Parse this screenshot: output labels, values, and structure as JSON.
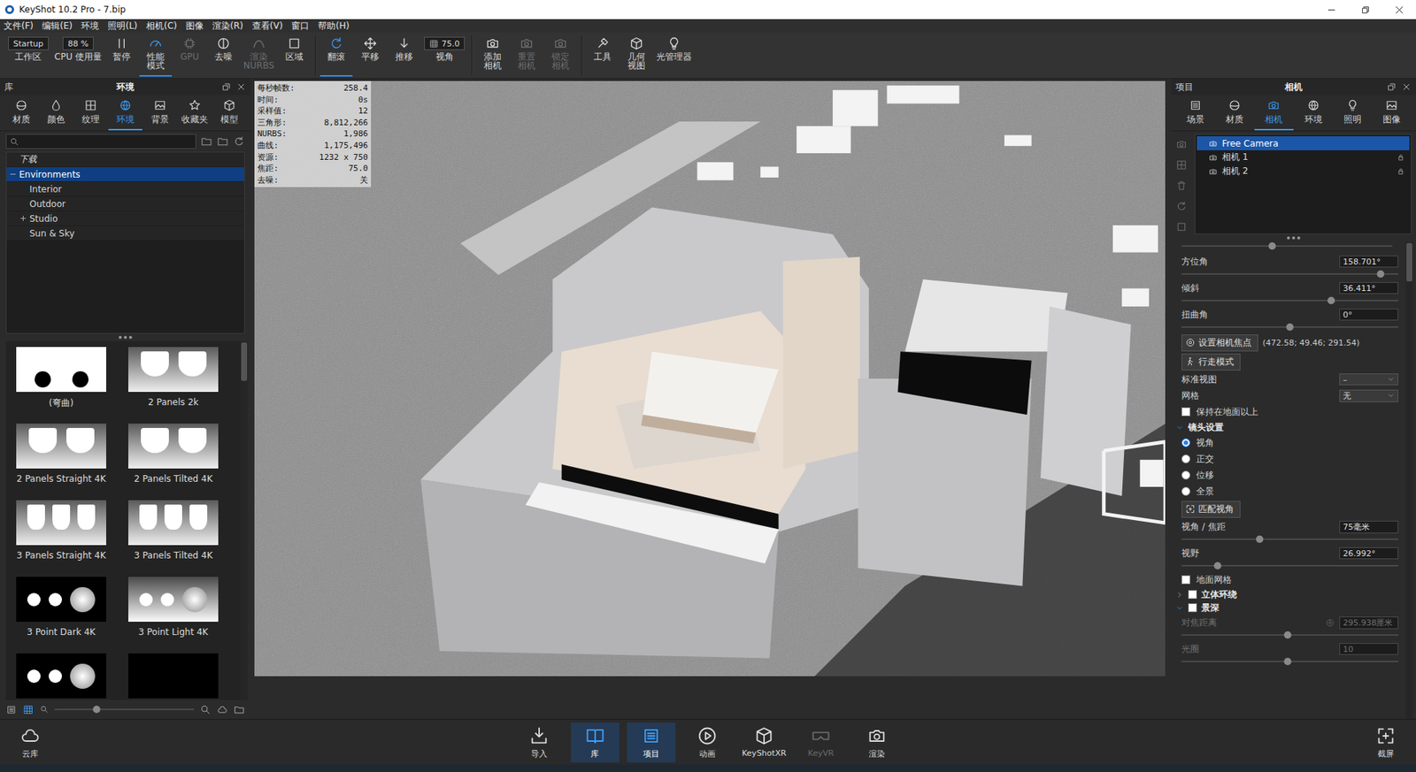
{
  "window": {
    "title": "KeyShot 10.2 Pro - 7.bip"
  },
  "menu": [
    "文件(F)",
    "编辑(E)",
    "环境",
    "照明(L)",
    "相机(C)",
    "图像",
    "渲染(R)",
    "查看(V)",
    "窗口",
    "帮助(H)"
  ],
  "toolbar": {
    "groups": [
      [
        {
          "kind": "field",
          "value": "Startup",
          "label": "工作区",
          "selected": false,
          "disabled": false
        },
        {
          "kind": "field",
          "value": "88 %",
          "label": "CPU 使用量",
          "selected": false,
          "disabled": false
        },
        {
          "kind": "icon",
          "label": "暂停",
          "selected": false,
          "disabled": false
        },
        {
          "kind": "icon",
          "label": "性能\n模式",
          "selected": true,
          "disabled": false
        },
        {
          "kind": "icon",
          "label": "GPU",
          "selected": false,
          "disabled": true
        },
        {
          "kind": "icon",
          "label": "去噪",
          "selected": false,
          "disabled": false
        },
        {
          "kind": "icon",
          "label": "渲染\nNURBS",
          "selected": false,
          "disabled": true
        },
        {
          "kind": "icon",
          "label": "区域",
          "selected": false,
          "disabled": false
        }
      ],
      [
        {
          "kind": "icon",
          "label": "翻滚",
          "selected": true,
          "disabled": false
        },
        {
          "kind": "icon",
          "label": "平移",
          "selected": false,
          "disabled": false
        },
        {
          "kind": "icon",
          "label": "推移",
          "selected": false,
          "disabled": false
        },
        {
          "kind": "field-icon",
          "value": "75.0",
          "label": "视角",
          "selected": false,
          "disabled": false
        }
      ],
      [
        {
          "kind": "icon",
          "label": "添加\n相机",
          "selected": false,
          "disabled": false
        },
        {
          "kind": "icon",
          "label": "重置\n相机",
          "selected": false,
          "disabled": true
        },
        {
          "kind": "icon",
          "label": "锁定\n相机",
          "selected": false,
          "disabled": true
        }
      ],
      [
        {
          "kind": "icon",
          "label": "工具",
          "selected": false,
          "disabled": false
        },
        {
          "kind": "icon",
          "label": "几何\n视图",
          "selected": false,
          "disabled": false
        },
        {
          "kind": "icon",
          "label": "光管理器",
          "selected": false,
          "disabled": false
        }
      ]
    ]
  },
  "library": {
    "header": "库",
    "title": "环境",
    "tabs": [
      {
        "label": "材质",
        "selected": false
      },
      {
        "label": "颜色",
        "selected": false
      },
      {
        "label": "纹理",
        "selected": false
      },
      {
        "label": "环境",
        "selected": true
      },
      {
        "label": "背景",
        "selected": false
      },
      {
        "label": "收藏夹",
        "selected": false
      },
      {
        "label": "模型",
        "selected": false
      }
    ],
    "tree": [
      {
        "label": "下载",
        "level": 0,
        "italic": true,
        "expandable": false,
        "expanded": false,
        "selected": false
      },
      {
        "label": "Environments",
        "level": 0,
        "italic": false,
        "expandable": true,
        "expanded": true,
        "selected": true
      },
      {
        "label": "Interior",
        "level": 1,
        "italic": false,
        "expandable": false,
        "expanded": false,
        "selected": false
      },
      {
        "label": "Outdoor",
        "level": 1,
        "italic": false,
        "expandable": false,
        "expanded": false,
        "selected": false
      },
      {
        "label": "Studio",
        "level": 1,
        "italic": false,
        "expandable": true,
        "expanded": false,
        "selected": false
      },
      {
        "label": "Sun & Sky",
        "level": 1,
        "italic": false,
        "expandable": false,
        "expanded": false,
        "selected": false
      }
    ],
    "thumbnails": [
      {
        "label": "(弯曲)",
        "kind": "blob"
      },
      {
        "label": "2 Panels 2k",
        "kind": "panels"
      },
      {
        "label": "2 Panels Straight 4K",
        "kind": "panels"
      },
      {
        "label": "2 Panels Tilted 4K",
        "kind": "panels"
      },
      {
        "label": "3 Panels Straight 4K",
        "kind": "panels3"
      },
      {
        "label": "3 Panels Tilted 4K",
        "kind": "panels3"
      },
      {
        "label": "3 Point Dark 4K",
        "kind": "dots-dark"
      },
      {
        "label": "3 Point Light 4K",
        "kind": "dots-light"
      },
      {
        "label": "",
        "kind": "dots-dark"
      },
      {
        "label": "",
        "kind": "black"
      }
    ],
    "zoom_level": 0.3
  },
  "viewport": {
    "stats": [
      {
        "label": "每秒帧数:",
        "value": "258.4"
      },
      {
        "label": "时间:",
        "value": "0s"
      },
      {
        "label": "采样值:",
        "value": "12"
      },
      {
        "label": "三角形:",
        "value": "8,812,266"
      },
      {
        "label": "NURBS:",
        "value": "1,986"
      },
      {
        "label": "曲线:",
        "value": "1,175,496"
      },
      {
        "label": "资源:",
        "value": "1232 x 750"
      },
      {
        "label": "焦距:",
        "value": "75.0"
      },
      {
        "label": "去噪:",
        "value": "关"
      }
    ]
  },
  "project": {
    "header": "项目",
    "title": "相机",
    "tabs": [
      {
        "label": "场景",
        "selected": false
      },
      {
        "label": "材质",
        "selected": false
      },
      {
        "label": "相机",
        "selected": true
      },
      {
        "label": "环境",
        "selected": false
      },
      {
        "label": "照明",
        "selected": false
      },
      {
        "label": "图像",
        "selected": false
      }
    ],
    "cameras": [
      {
        "name": "Free Camera",
        "selected": true,
        "locked": false
      },
      {
        "name": "相机 1",
        "selected": false,
        "locked": true
      },
      {
        "name": "相机 2",
        "selected": false,
        "locked": true
      }
    ],
    "list_zoom_level": 0.43,
    "angles": [
      {
        "label": "方位角",
        "value": "158.701°",
        "level": 0.92
      },
      {
        "label": "倾斜",
        "value": "36.411°",
        "level": 0.69
      },
      {
        "label": "扭曲角",
        "value": "0°",
        "level": 0.5
      }
    ],
    "focus": {
      "button": "设置相机焦点",
      "coords": "(472.58; 49.46; 291.54)"
    },
    "walk_button": "行走模式",
    "dropdowns": [
      {
        "label": "标准视图",
        "value": "–"
      },
      {
        "label": "网格",
        "value": "无"
      }
    ],
    "keep_above_ground": {
      "label": "保持在地面以上",
      "checked": false
    },
    "lens": {
      "title": "镜头设置",
      "expanded": true,
      "options": [
        {
          "label": "视角",
          "selected": true
        },
        {
          "label": "正交",
          "selected": false
        },
        {
          "label": "位移",
          "selected": false
        },
        {
          "label": "全景",
          "selected": false
        }
      ],
      "match_button": "匹配视角",
      "sliders": [
        {
          "label": "视角 / 焦距",
          "value": "75毫米",
          "level": 0.36
        },
        {
          "label": "视野",
          "value": "26.992°",
          "level": 0.165
        }
      ],
      "ground_grid": {
        "label": "地面网格",
        "checked": false
      }
    },
    "sections": [
      {
        "title": "立体环绕",
        "expanded": false,
        "checked": false
      },
      {
        "title": "景深",
        "expanded": true,
        "checked": false
      }
    ],
    "dof": [
      {
        "label": "对焦距离",
        "value": "295.938厘米",
        "level": 0.49,
        "disabled": true
      },
      {
        "label": "光圈",
        "value": "10",
        "level": 0.49,
        "disabled": true
      }
    ]
  },
  "bottom_bar": {
    "left": {
      "label": "云库"
    },
    "center": [
      {
        "label": "导入",
        "selected": false,
        "disabled": false
      },
      {
        "label": "库",
        "selected": true,
        "disabled": false
      },
      {
        "label": "项目",
        "selected": true,
        "disabled": false
      },
      {
        "label": "动画",
        "selected": false,
        "disabled": false
      },
      {
        "label": "KeyShotXR",
        "selected": false,
        "disabled": false
      },
      {
        "label": "KeyVR",
        "selected": false,
        "disabled": true
      },
      {
        "label": "渲染",
        "selected": false,
        "disabled": false
      }
    ],
    "right": {
      "label": "截屏"
    }
  }
}
